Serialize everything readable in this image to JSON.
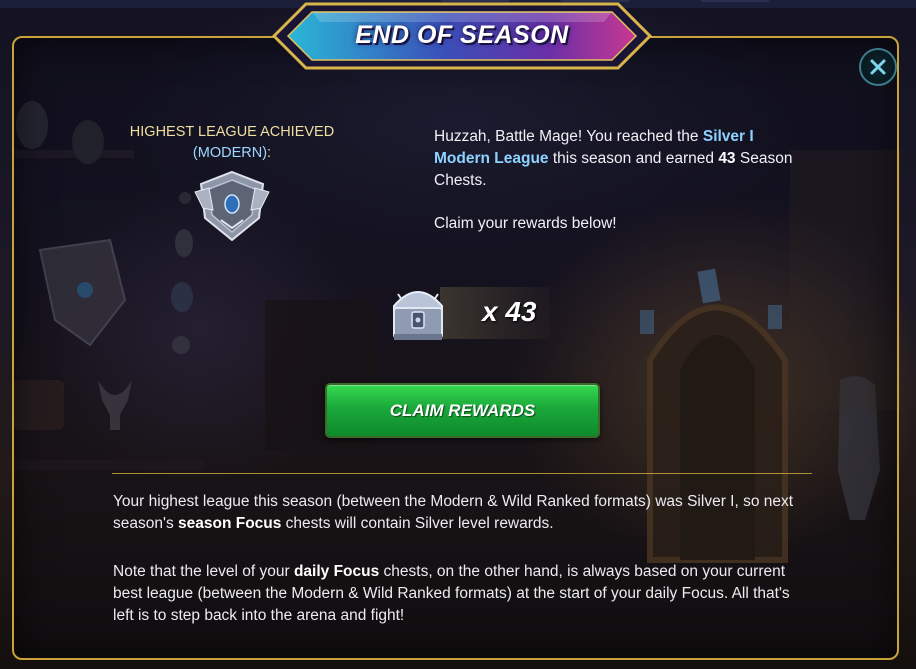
{
  "modal": {
    "title": "END OF SEASON",
    "close_icon": "close-icon"
  },
  "league": {
    "heading": "HIGHEST LEAGUE ACHIEVED",
    "format": "(MODERN)",
    "format_suffix": ":",
    "emblem_icon": "silver-league-emblem-icon"
  },
  "message": {
    "greeting": "Huzzah, Battle Mage! You reached the ",
    "league_name": "Silver I Modern League",
    "middle": " this season and earned ",
    "chest_count": "43",
    "end": " Season Chests.",
    "claim_prompt": "Claim your rewards below!"
  },
  "reward": {
    "chest_icon": "season-chest-icon",
    "count_label": "x 43"
  },
  "claim_button": {
    "label": "CLAIM REWARDS"
  },
  "info": {
    "p1_a": "Your highest league this season (between the Modern & Wild Ranked formats) was Silver I, so next season's ",
    "p1_bold": "season Focus",
    "p1_b": " chests will contain Silver level rewards.",
    "p2_a": "Note that the level of your ",
    "p2_bold": "daily Focus",
    "p2_b": " chests, on the other hand, is always based on your current best league (between the Modern & Wild Ranked formats) at the start of your daily Focus. All that's left is to step back into the arena and fight!"
  },
  "colors": {
    "frame_gold": "#c9a33a",
    "highlight_blue": "#8ed3ff",
    "button_green": "#1aa83a",
    "heading_gold": "#f0dfa0"
  }
}
